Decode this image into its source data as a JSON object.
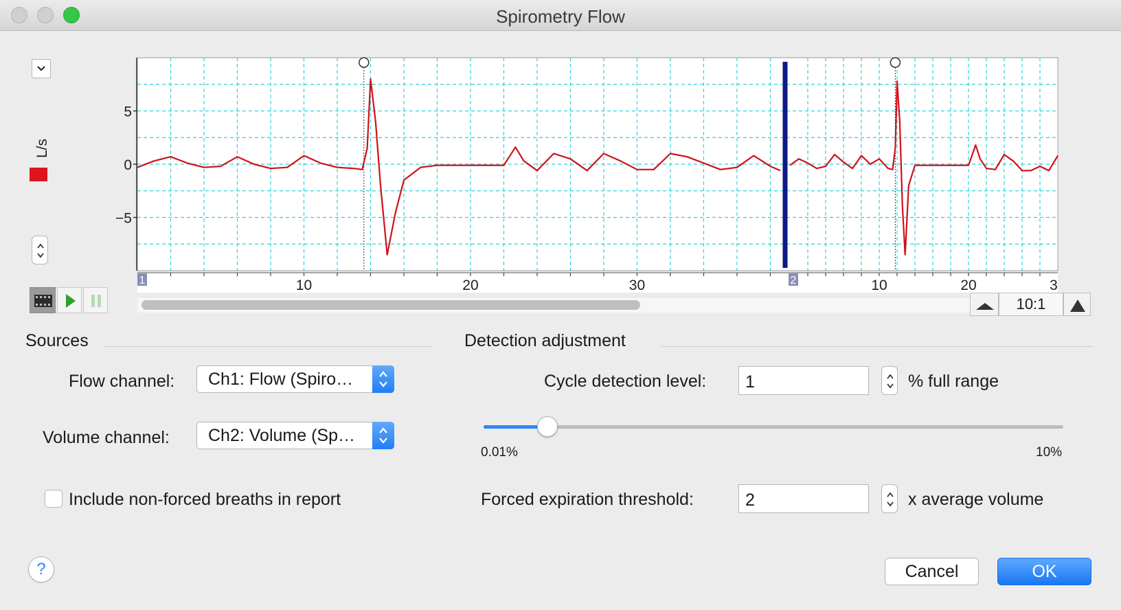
{
  "window": {
    "title": "Spirometry Flow"
  },
  "chart_panel": {
    "units_label": "L/s",
    "channel_color": "#e0141c",
    "ratio_label": "10:1",
    "block_markers": [
      "1",
      "2"
    ]
  },
  "chart_data": {
    "type": "line",
    "title": "",
    "ylabel": "L/s",
    "xlabel": "",
    "ylim": [
      -10,
      10
    ],
    "yticks": [
      "5",
      "0",
      "−5"
    ],
    "blocks": [
      {
        "name": "1",
        "xlim": [
          0,
          38.6
        ],
        "xticks": [
          "10",
          "20",
          "30"
        ],
        "cycle_marker_x": 13.6,
        "x": [
          0,
          1,
          2,
          3,
          4,
          5,
          6,
          7,
          8,
          9,
          10,
          11,
          12,
          13,
          13.5,
          13.8,
          14.0,
          14.3,
          14.6,
          15.0,
          15.5,
          16,
          17,
          18,
          19,
          20,
          21,
          22,
          22.7,
          23.2,
          24,
          25,
          26,
          27,
          28,
          29,
          30,
          31,
          32,
          33,
          34,
          35,
          36,
          37,
          38,
          38.6
        ],
        "y": [
          -0.3,
          0.3,
          0.7,
          0.1,
          -0.3,
          -0.2,
          0.7,
          0.0,
          -0.4,
          -0.3,
          0.8,
          0.1,
          -0.3,
          -0.4,
          -0.5,
          1.5,
          8.0,
          4.0,
          -2.0,
          -8.5,
          -4.5,
          -1.5,
          -0.3,
          -0.1,
          -0.1,
          -0.1,
          -0.1,
          -0.1,
          1.6,
          0.3,
          -0.6,
          1.0,
          0.5,
          -0.6,
          1.0,
          0.3,
          -0.5,
          -0.5,
          1.0,
          0.7,
          0.1,
          -0.5,
          -0.3,
          0.8,
          -0.2,
          -0.6
        ]
      },
      {
        "name": "2",
        "xlim": [
          0,
          30
        ],
        "xticks": [
          "10",
          "20",
          "3"
        ],
        "cycle_marker_x": 11.8,
        "x": [
          0,
          1,
          2,
          3,
          4,
          5,
          6,
          7,
          8,
          9,
          10,
          11,
          11.5,
          11.8,
          12.0,
          12.3,
          12.6,
          12.9,
          13.3,
          14,
          15,
          16,
          17,
          18,
          19,
          20,
          20.8,
          21.3,
          22,
          23,
          24,
          25,
          26,
          27,
          28,
          29,
          30
        ],
        "y": [
          -0.1,
          0.5,
          0.1,
          -0.4,
          -0.2,
          0.9,
          0.2,
          -0.4,
          0.8,
          0.0,
          0.5,
          -0.4,
          -0.5,
          1.5,
          7.8,
          4.0,
          -4.0,
          -8.5,
          -2.0,
          -0.1,
          -0.1,
          -0.1,
          -0.1,
          -0.1,
          -0.1,
          -0.1,
          1.8,
          0.5,
          -0.4,
          -0.5,
          0.9,
          0.3,
          -0.6,
          -0.6,
          -0.2,
          -0.6,
          0.8
        ]
      }
    ],
    "grid": true
  },
  "sources": {
    "heading": "Sources",
    "flow_label": "Flow channel:",
    "flow_value": "Ch1: Flow (Spiro…",
    "volume_label": "Volume channel:",
    "volume_value": "Ch2: Volume (Sp…",
    "include_label": "Include non-forced breaths in report",
    "include_checked": false
  },
  "detection": {
    "heading": "Detection adjustment",
    "cycle_label": "Cycle detection level:",
    "cycle_value": "1",
    "cycle_unit": "% full range",
    "slider_min_label": "0.01%",
    "slider_max_label": "10%",
    "slider_fraction": 0.11,
    "forced_label": "Forced expiration threshold:",
    "forced_value": "2",
    "forced_unit": "x average volume"
  },
  "buttons": {
    "cancel": "Cancel",
    "ok": "OK",
    "help": "?"
  }
}
